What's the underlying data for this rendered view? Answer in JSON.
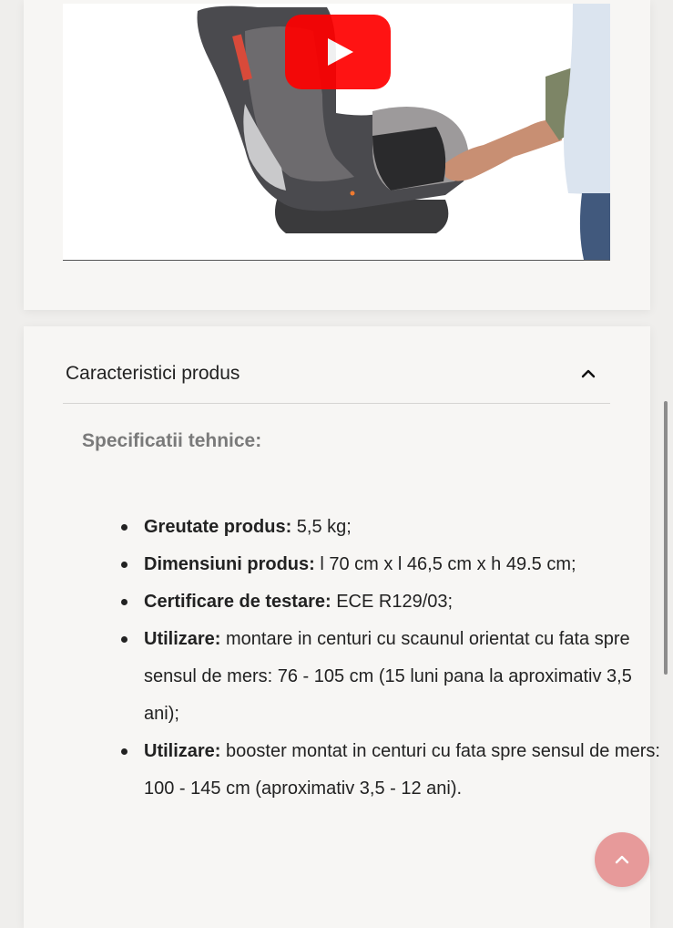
{
  "video": {
    "play_icon": "youtube-play-icon",
    "image_subject": "child car seat with adult hand adjusting footrest"
  },
  "accordion": {
    "title": "Caracteristici produs",
    "toggle_icon": "chevron-up-icon",
    "expanded": true
  },
  "specs": {
    "heading": "Specificatii tehnice:",
    "items": [
      {
        "label": "Greutate produs:",
        "value": " 5,5 kg;"
      },
      {
        "label": "Dimensiuni produs:",
        "value": " l 70 cm x l 46,5 cm x h 49.5 cm;"
      },
      {
        "label": "Certificare de testare:",
        "value": " ECE R129/03;"
      },
      {
        "label": "Utilizare:",
        "value": " montare in centuri cu scaunul orientat cu fata spre sensul de mers: 76 - 105 cm (15 luni pana la aproximativ 3,5 ani);"
      },
      {
        "label": "Utilizare:",
        "value": " booster montat in centuri cu fata spre sensul de mers: 100 - 145 cm (aproximativ 3,5 - 12 ani)."
      }
    ]
  },
  "back_to_top": {
    "icon": "chevron-up-icon"
  },
  "colors": {
    "page_bg": "#efeeec",
    "card_bg": "#f7f6f4",
    "youtube_red": "#ff0000",
    "back_to_top_bg": "#e79a9a",
    "heading_gray": "#7a7a7a"
  }
}
